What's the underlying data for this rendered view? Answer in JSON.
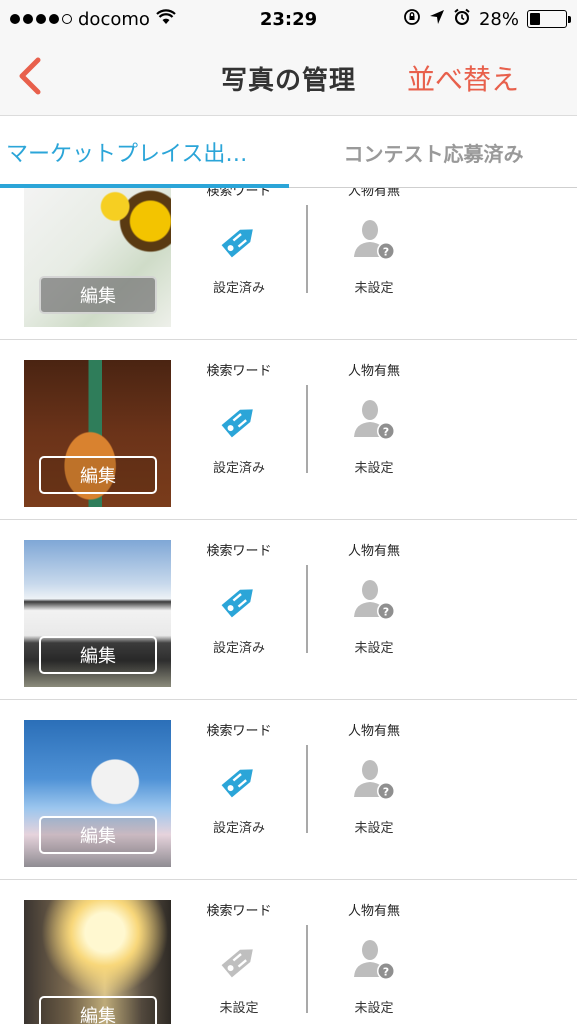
{
  "status_bar": {
    "carrier": "docomo",
    "time": "23:29",
    "battery": "28%",
    "battery_level": 0.28
  },
  "nav": {
    "back_icon": "chevron-left-icon",
    "title": "写真の管理",
    "sort_label": "並べ替え"
  },
  "tabs": [
    {
      "label": "マーケットプレイス出…",
      "active": true
    },
    {
      "label": "コンテスト応募済み",
      "active": false
    }
  ],
  "colors": {
    "accent_blue": "#2ba5d8",
    "accent_red": "#e8604c",
    "tag_inactive": "#bfbfbf",
    "person_icon": "#bdbdbd"
  },
  "photos": [
    {
      "edit_label": "編集",
      "keyword_label": "検索ワード",
      "keyword_status": "設定済み",
      "keyword_set": true,
      "person_label": "人物有無",
      "person_status": "未設定",
      "thumb": "sunflower"
    },
    {
      "edit_label": "編集",
      "keyword_label": "検索ワード",
      "keyword_status": "設定済み",
      "keyword_set": true,
      "person_label": "人物有無",
      "person_status": "未設定",
      "thumb": "pens"
    },
    {
      "edit_label": "編集",
      "keyword_label": "検索ワード",
      "keyword_status": "設定済み",
      "keyword_set": true,
      "person_label": "人物有無",
      "person_status": "未設定",
      "thumb": "gate"
    },
    {
      "edit_label": "編集",
      "keyword_label": "検索ワード",
      "keyword_status": "設定済み",
      "keyword_set": true,
      "person_label": "人物有無",
      "person_status": "未設定",
      "thumb": "castle"
    },
    {
      "edit_label": "編集",
      "keyword_label": "検索ワード",
      "keyword_status": "未設定",
      "keyword_set": false,
      "person_label": "人物有無",
      "person_status": "未設定",
      "thumb": "sunset"
    }
  ]
}
